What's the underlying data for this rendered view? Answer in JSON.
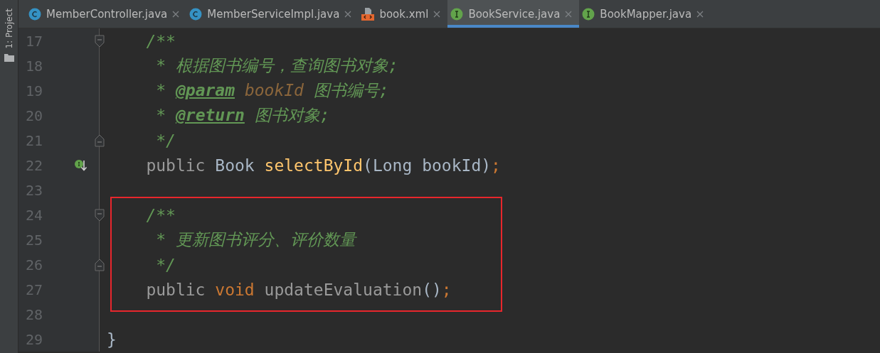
{
  "tool_strip": {
    "label": "1: Project"
  },
  "tabs": [
    {
      "label": "MemberController.java",
      "kind": "class",
      "selected": false
    },
    {
      "label": "MemberServiceImpl.java",
      "kind": "class",
      "selected": false
    },
    {
      "label": "book.xml",
      "kind": "xml",
      "selected": false
    },
    {
      "label": "BookService.java",
      "kind": "interface",
      "selected": true
    },
    {
      "label": "BookMapper.java",
      "kind": "interface",
      "selected": false
    }
  ],
  "lines": [
    {
      "number": "17",
      "fold_start": true,
      "fold_end": false,
      "implemented": false,
      "highlighted": false,
      "tokens": [
        {
          "text": "    /**",
          "kind": "comment"
        }
      ]
    },
    {
      "number": "18",
      "fold_start": false,
      "fold_end": false,
      "implemented": false,
      "highlighted": false,
      "tokens": [
        {
          "text": "     * 根据图书编号，查询图书对象;",
          "kind": "comment"
        }
      ]
    },
    {
      "number": "19",
      "fold_start": false,
      "fold_end": false,
      "implemented": false,
      "highlighted": false,
      "tokens": [
        {
          "text": "     * ",
          "kind": "comment"
        },
        {
          "text": "@param",
          "kind": "doc-tag"
        },
        {
          "text": " bookId",
          "kind": "param-name"
        },
        {
          "text": " 图书编号;",
          "kind": "comment"
        }
      ]
    },
    {
      "number": "20",
      "fold_start": false,
      "fold_end": false,
      "implemented": false,
      "highlighted": false,
      "tokens": [
        {
          "text": "     * ",
          "kind": "comment"
        },
        {
          "text": "@return",
          "kind": "doc-tag"
        },
        {
          "text": " 图书对象;",
          "kind": "comment"
        }
      ]
    },
    {
      "number": "21",
      "fold_start": false,
      "fold_end": true,
      "implemented": false,
      "highlighted": false,
      "tokens": [
        {
          "text": "     */",
          "kind": "comment"
        }
      ]
    },
    {
      "number": "22",
      "fold_start": false,
      "fold_end": false,
      "implemented": true,
      "highlighted": false,
      "tokens": [
        {
          "text": "    public",
          "kind": "redundant"
        },
        {
          "text": " Book ",
          "kind": "plain"
        },
        {
          "text": "selectById",
          "kind": "method"
        },
        {
          "text": "(Long bookId)",
          "kind": "plain"
        },
        {
          "text": ";",
          "kind": "keyword"
        }
      ]
    },
    {
      "number": "23",
      "fold_start": false,
      "fold_end": false,
      "implemented": false,
      "highlighted": false
    },
    {
      "number": "24",
      "fold_start": true,
      "fold_end": false,
      "implemented": false,
      "highlighted": true,
      "tokens": [
        {
          "text": "    /**",
          "kind": "comment"
        }
      ]
    },
    {
      "number": "25",
      "fold_start": false,
      "fold_end": false,
      "implemented": false,
      "highlighted": true,
      "tokens": [
        {
          "text": "     * 更新图书评分、评价数量",
          "kind": "comment"
        }
      ]
    },
    {
      "number": "26",
      "fold_start": false,
      "fold_end": true,
      "implemented": false,
      "highlighted": true,
      "tokens": [
        {
          "text": "     */",
          "kind": "comment"
        }
      ]
    },
    {
      "number": "27",
      "fold_start": false,
      "fold_end": false,
      "implemented": false,
      "highlighted": true,
      "tokens": [
        {
          "text": "    public",
          "kind": "redundant"
        },
        {
          "text": " void",
          "kind": "keyword"
        },
        {
          "text": " updateEvaluation",
          "kind": "redundant"
        },
        {
          "text": "()",
          "kind": "plain"
        },
        {
          "text": ";",
          "kind": "keyword"
        }
      ]
    },
    {
      "number": "28",
      "fold_start": false,
      "fold_end": false,
      "implemented": false,
      "highlighted": false
    },
    {
      "number": "29",
      "fold_start": false,
      "fold_end": false,
      "implemented": false,
      "highlighted": false,
      "tokens": [
        {
          "text": "}",
          "kind": "plain"
        }
      ]
    }
  ]
}
